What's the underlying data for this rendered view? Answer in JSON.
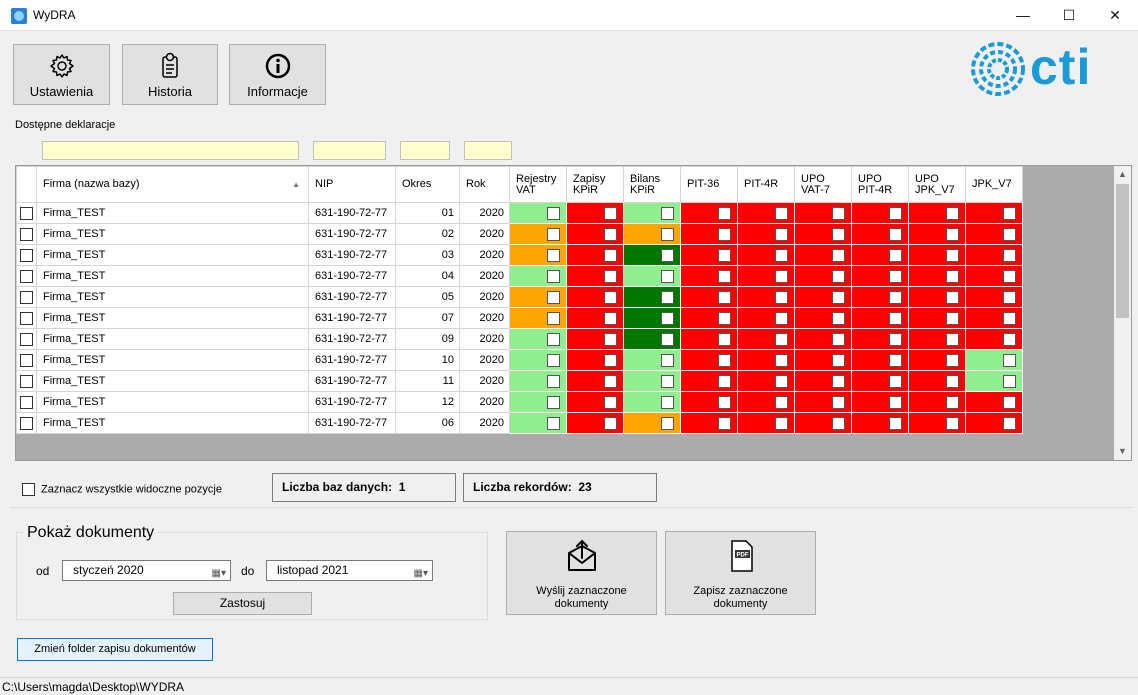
{
  "window": {
    "title": "WyDRA",
    "minimize": "—",
    "maximize": "☐",
    "close": "✕"
  },
  "toolbar": {
    "settings_label": "Ustawienia",
    "history_label": "Historia",
    "info_label": "Informacje"
  },
  "logo": {
    "text": "cti"
  },
  "declarations_group": {
    "label": "Dostępne deklaracje"
  },
  "filters": {
    "firma": "",
    "nip": "",
    "okres": "",
    "rok": ""
  },
  "grid": {
    "columns": [
      "",
      "Firma (nazwa bazy)",
      "NIP",
      "Okres",
      "Rok",
      "Rejestry VAT",
      "Zapisy KPiR",
      "Bilans KPiR",
      "PIT-36",
      "PIT-4R",
      "UPO VAT-7",
      "UPO PIT-4R",
      "UPO JPK_V7",
      "JPK_V7"
    ],
    "sort_indicator": "▲",
    "rows": [
      {
        "firma": "Firma_TEST",
        "nip": "631-190-72-77",
        "okres": "01",
        "rok": "2020",
        "status": [
          "lg",
          "red",
          "lg",
          "red",
          "red",
          "red",
          "red",
          "red",
          "red"
        ]
      },
      {
        "firma": "Firma_TEST",
        "nip": "631-190-72-77",
        "okres": "02",
        "rok": "2020",
        "status": [
          "or",
          "red",
          "or",
          "red",
          "red",
          "red",
          "red",
          "red",
          "red"
        ]
      },
      {
        "firma": "Firma_TEST",
        "nip": "631-190-72-77",
        "okres": "03",
        "rok": "2020",
        "status": [
          "or",
          "red",
          "dg",
          "red",
          "red",
          "red",
          "red",
          "red",
          "red"
        ]
      },
      {
        "firma": "Firma_TEST",
        "nip": "631-190-72-77",
        "okres": "04",
        "rok": "2020",
        "status": [
          "lg",
          "red",
          "lg",
          "red",
          "red",
          "red",
          "red",
          "red",
          "red"
        ]
      },
      {
        "firma": "Firma_TEST",
        "nip": "631-190-72-77",
        "okres": "05",
        "rok": "2020",
        "status": [
          "or",
          "red",
          "dg",
          "red",
          "red",
          "red",
          "red",
          "red",
          "red"
        ]
      },
      {
        "firma": "Firma_TEST",
        "nip": "631-190-72-77",
        "okres": "07",
        "rok": "2020",
        "status": [
          "or",
          "red",
          "dg",
          "red",
          "red",
          "red",
          "red",
          "red",
          "red"
        ]
      },
      {
        "firma": "Firma_TEST",
        "nip": "631-190-72-77",
        "okres": "09",
        "rok": "2020",
        "status": [
          "lg",
          "red",
          "dg",
          "red",
          "red",
          "red",
          "red",
          "red",
          "red"
        ]
      },
      {
        "firma": "Firma_TEST",
        "nip": "631-190-72-77",
        "okres": "10",
        "rok": "2020",
        "status": [
          "lg",
          "red",
          "lg",
          "red",
          "red",
          "red",
          "red",
          "red",
          "lg"
        ]
      },
      {
        "firma": "Firma_TEST",
        "nip": "631-190-72-77",
        "okres": "11",
        "rok": "2020",
        "status": [
          "lg",
          "red",
          "lg",
          "red",
          "red",
          "red",
          "red",
          "red",
          "lg"
        ]
      },
      {
        "firma": "Firma_TEST",
        "nip": "631-190-72-77",
        "okres": "12",
        "rok": "2020",
        "status": [
          "lg",
          "red",
          "lg",
          "red",
          "red",
          "red",
          "red",
          "red",
          "red"
        ]
      },
      {
        "firma": "Firma_TEST",
        "nip": "631-190-72-77",
        "okres": "06",
        "rok": "2020",
        "status": [
          "lg",
          "red",
          "or",
          "red",
          "red",
          "red",
          "red",
          "red",
          "red"
        ]
      }
    ]
  },
  "selection": {
    "select_all_label": "Zaznacz wszystkie widoczne pozycje"
  },
  "counts": {
    "db_label": "Liczba baz danych:",
    "db_value": "1",
    "records_label": "Liczba rekordów:",
    "records_value": "23"
  },
  "show_docs": {
    "title": "Pokaż dokumenty",
    "from_label": "od",
    "from_value": "styczeń   2020",
    "to_label": "do",
    "to_value": "listopad   2021",
    "apply_label": "Zastosuj"
  },
  "actions": {
    "send_label_1": "Wyślij zaznaczone",
    "send_label_2": "dokumenty",
    "save_label_1": "Zapisz zaznaczone",
    "save_label_2": "dokumenty",
    "pdf_badge": "PDF"
  },
  "folder": {
    "change_label": "Zmień folder zapisu dokumentów"
  },
  "status": {
    "path": "C:\\Users\\magda\\Desktop\\WYDRA"
  },
  "colors": {
    "red": "#ff0000",
    "lg": "#90ee90",
    "or": "#ffa500",
    "dg": "#007800",
    "brand": "#1a9ad6"
  }
}
